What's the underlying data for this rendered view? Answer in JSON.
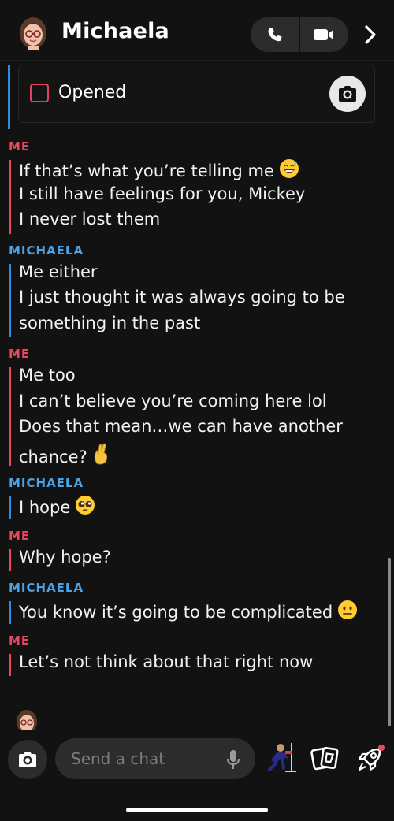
{
  "header": {
    "contact_name": "Michaela",
    "avatar_icon": "bitmoji-avatar",
    "call_icon": "phone-icon",
    "video_icon": "video-camera-icon",
    "more_icon": "chevron-right-icon"
  },
  "snap": {
    "status_label": "Opened",
    "status_color": "#e2405c"
  },
  "messages": [
    {
      "sender": "ME",
      "side": "me",
      "lines": [
        "If that’s what you’re telling me",
        "I still have feelings for you, Mickey",
        "I never lost them"
      ],
      "emoji": {
        "line": 0,
        "name": "grinning-sweat-emoji"
      }
    },
    {
      "sender": "MICHAELA",
      "side": "her",
      "lines": [
        "Me either",
        "I just thought it was always going to be",
        "something in the past"
      ]
    },
    {
      "sender": "ME",
      "side": "me",
      "lines": [
        "Me too",
        "I can’t believe you’re coming here lol",
        "Does that mean…we can have another",
        "chance?"
      ],
      "emoji": {
        "line": 3,
        "name": "crossed-fingers-emoji"
      }
    },
    {
      "sender": "MICHAELA",
      "side": "her",
      "lines": [
        "I hope"
      ],
      "emoji": {
        "line": 0,
        "name": "pleading-face-emoji"
      }
    },
    {
      "sender": "ME",
      "side": "me",
      "lines": [
        "Why hope?"
      ]
    },
    {
      "sender": "MICHAELA",
      "side": "her",
      "lines": [
        "You know it’s going to be complicated"
      ],
      "emoji": {
        "line": 0,
        "name": "neutral-face-emoji"
      }
    },
    {
      "sender": "ME",
      "side": "me",
      "lines": [
        "Let’s not think about that right now"
      ]
    }
  ],
  "composer": {
    "placeholder": "Send a chat",
    "camera_icon": "camera-icon",
    "mic_icon": "microphone-icon",
    "bitmoji_icon": "bitmoji-sticker-icon",
    "cards_icon": "cards-icon",
    "rocket_icon": "rocket-icon"
  },
  "colors": {
    "me": "#e8475e",
    "her": "#4ba3e6",
    "background": "#121212"
  }
}
